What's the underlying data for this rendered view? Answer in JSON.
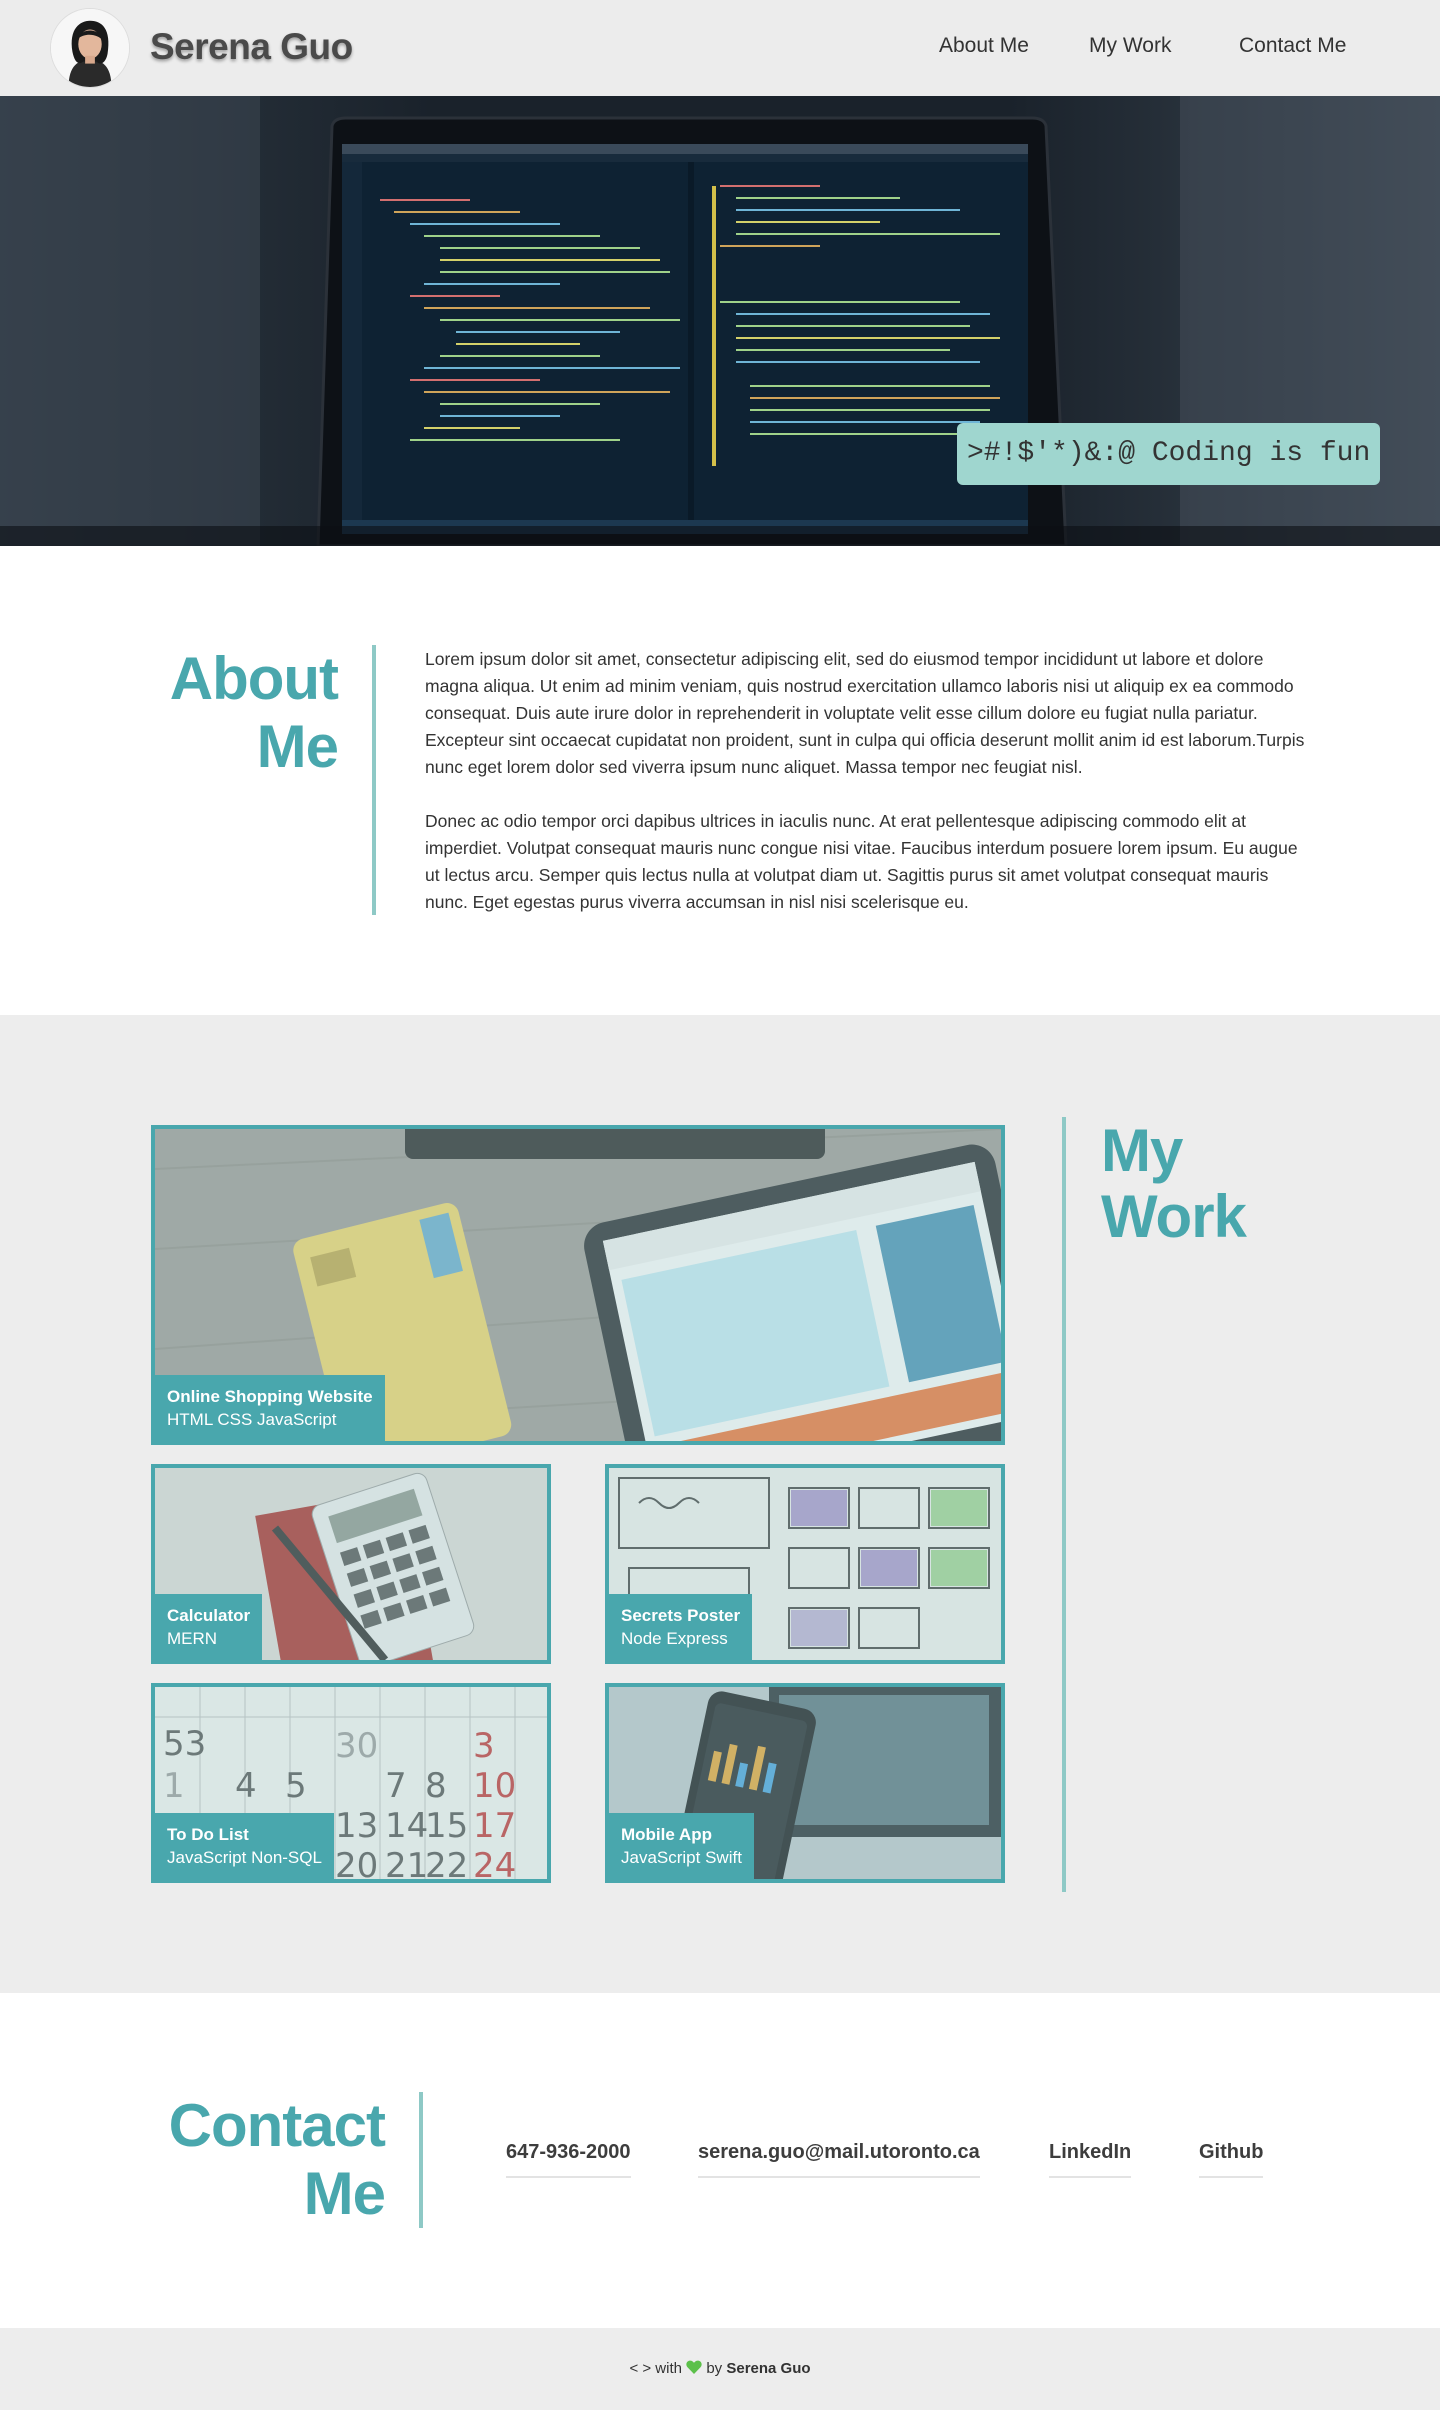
{
  "header": {
    "brand": "Serena Guo",
    "nav": [
      "About Me",
      "My Work",
      "Contact Me"
    ]
  },
  "hero": {
    "tagline": ">#!$'*)&:@ Coding is fun"
  },
  "about": {
    "title_line1": "About",
    "title_line2": "Me",
    "paragraphs": [
      "Lorem ipsum dolor sit amet, consectetur adipiscing elit, sed do eiusmod tempor incididunt ut labore et dolore magna aliqua. Ut enim ad minim veniam, quis nostrud exercitation ullamco laboris nisi ut aliquip ex ea commodo consequat. Duis aute irure dolor in reprehenderit in voluptate velit esse cillum dolore eu fugiat nulla pariatur. Excepteur sint occaecat cupidatat non proident, sunt in culpa qui officia deserunt mollit anim id est laborum.Turpis nunc eget lorem dolor sed viverra ipsum nunc aliquet. Massa tempor nec feugiat nisl.",
      "Donec ac odio tempor orci dapibus ultrices in iaculis nunc. At erat pellentesque adipiscing commodo elit at imperdiet. Volutpat consequat mauris nunc congue nisi vitae. Faucibus interdum posuere lorem ipsum. Eu augue ut lectus arcu. Semper quis lectus nulla at volutpat diam ut. Sagittis purus sit amet volutpat consequat mauris nunc. Eget egestas purus viverra accumsan in nisl nisi scelerisque eu."
    ]
  },
  "work": {
    "title_line1": "My",
    "title_line2": "Work",
    "projects": [
      {
        "title": "Online Shopping Website",
        "tech": "HTML CSS JavaScript"
      },
      {
        "title": "Calculator",
        "tech": "MERN"
      },
      {
        "title": "Secrets Poster",
        "tech": "Node Express"
      },
      {
        "title": "To Do List",
        "tech": "JavaScript Non-SQL"
      },
      {
        "title": "Mobile App",
        "tech": "JavaScript Swift"
      }
    ]
  },
  "contact": {
    "title_line1": "Contact",
    "title_line2": "Me",
    "links": [
      "647-936-2000",
      "serena.guo@mail.utoronto.ca",
      "LinkedIn",
      "Github"
    ]
  },
  "footer": {
    "prefix": "< > with",
    "by": "by",
    "author": "Serena Guo"
  },
  "colors": {
    "accent": "#49a7ad",
    "rule": "#8ec9c6",
    "tagline_bg": "#9fd6cf",
    "section_bg": "#ededed",
    "heart": "#5cc04a"
  }
}
